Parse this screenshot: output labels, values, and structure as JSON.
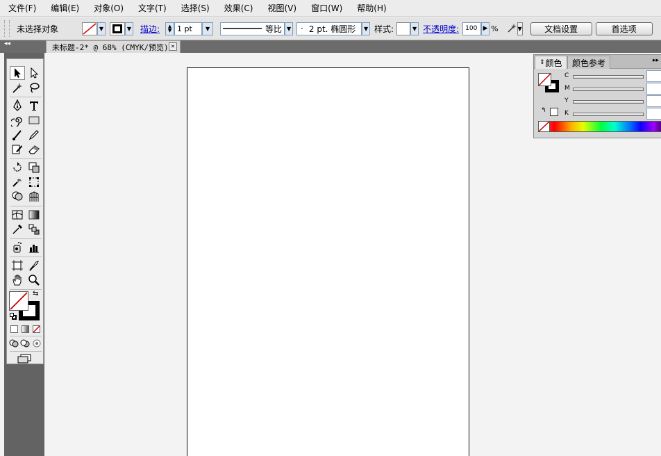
{
  "menubar": {
    "items": [
      "文件(F)",
      "编辑(E)",
      "对象(O)",
      "文字(T)",
      "选择(S)",
      "效果(C)",
      "视图(V)",
      "窗口(W)",
      "帮助(H)"
    ]
  },
  "controlbar": {
    "selection_status": "未选择对象",
    "stroke_label": "描边:",
    "stroke_weight": "1 pt",
    "profile_label": "等比",
    "brush_label": "2 pt. 椭圆形",
    "brush_dot": "·",
    "style_label": "样式:",
    "opacity_label": "不透明度:",
    "opacity_value": "100",
    "opacity_unit": "%",
    "doc_setup_button": "文档设置",
    "preferences_button": "首选项"
  },
  "tabstrip": {
    "collapse_glyph": "◂◂",
    "document_tab": "未标题-2* @ 68% (CMYK/预览)",
    "close_glyph": "✕"
  },
  "color_panel": {
    "tab_color": "颜色",
    "tab_guide": "颜色参考",
    "tab_arrow": "⇕",
    "menu_glyph": "▸▸",
    "channels": [
      {
        "label": "C",
        "value": ""
      },
      {
        "label": "M",
        "value": ""
      },
      {
        "label": "Y",
        "value": ""
      },
      {
        "label": "K",
        "value": ""
      }
    ]
  },
  "colors": {
    "chrome_dark": "#636363",
    "link_blue": "#0000cc",
    "none_red": "#cc0000"
  }
}
